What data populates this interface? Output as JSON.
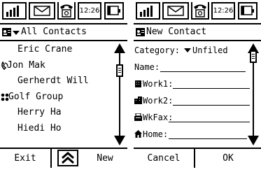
{
  "status": {
    "time": "12:26"
  },
  "left_screen": {
    "title": "All Contacts",
    "contacts": [
      {
        "name": "Eric Crane",
        "icon": ""
      },
      {
        "name": "Jon Mak",
        "icon": "handset-icon"
      },
      {
        "name": "Gerherdt Will",
        "icon": ""
      },
      {
        "name": "Golf Group",
        "icon": "group-icon"
      },
      {
        "name": "Herry Ha",
        "icon": ""
      },
      {
        "name": "Hiedi Ho",
        "icon": ""
      }
    ],
    "softkeys": {
      "left": "Exit",
      "right": "New"
    }
  },
  "right_screen": {
    "title": "New Contact",
    "category_label": "Category:",
    "category_value": "Unfiled",
    "fields": {
      "name": "Name:",
      "work1": "Work1:",
      "work2": "Work2:",
      "wkfax": "WkFax:",
      "home": "Home:"
    },
    "softkeys": {
      "left": "Cancel",
      "right": "OK"
    }
  }
}
